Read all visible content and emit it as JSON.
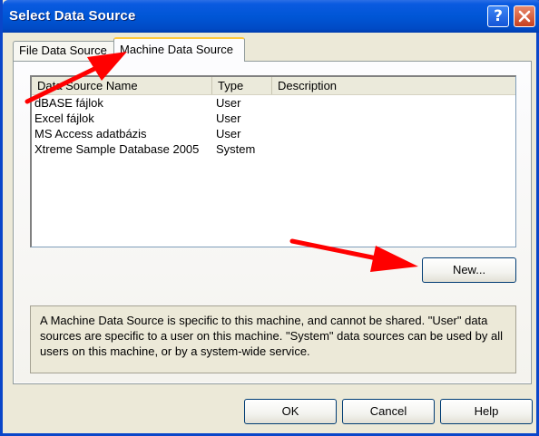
{
  "window": {
    "title": "Select Data Source"
  },
  "tabs": [
    {
      "label": "File Data Source",
      "selected": false
    },
    {
      "label": "Machine Data Source",
      "selected": true
    }
  ],
  "list": {
    "columns": [
      "Data Source Name",
      "Type",
      "Description"
    ],
    "rows": [
      {
        "name": "dBASE fájlok",
        "type": "User",
        "description": ""
      },
      {
        "name": "Excel fájlok",
        "type": "User",
        "description": ""
      },
      {
        "name": "MS Access adatbázis",
        "type": "User",
        "description": ""
      },
      {
        "name": "Xtreme Sample Database 2005",
        "type": "System",
        "description": ""
      }
    ]
  },
  "new_button": {
    "label": "New..."
  },
  "description_text": "A Machine Data Source is specific to this machine, and cannot be shared. \"User\" data sources are specific to a user on this machine. \"System\" data sources can be used by all users on this machine, or by a system-wide service.",
  "buttons": {
    "ok": "OK",
    "cancel": "Cancel",
    "help": "Help"
  },
  "titlebar_buttons": {
    "help": "?"
  },
  "colors": {
    "titlebar": "#0056d6",
    "annotation_arrow": "#ff0000",
    "tab_highlight": "#ffc83c"
  },
  "icons": {
    "help": "question-mark-icon",
    "close": "close-x-icon",
    "annotation": "red-arrow"
  }
}
